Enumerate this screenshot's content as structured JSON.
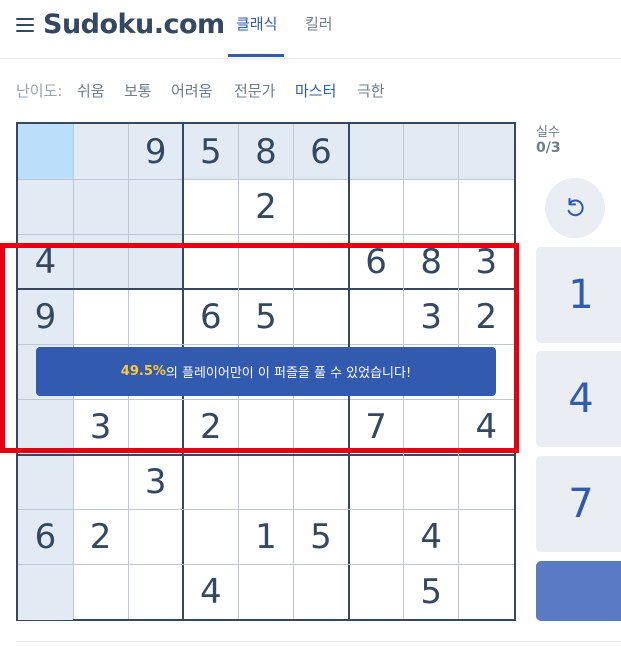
{
  "header": {
    "logo": "Sudoku.com",
    "tabs": [
      {
        "label": "클래식",
        "active": true
      },
      {
        "label": "킬러",
        "active": false
      }
    ]
  },
  "difficulty": {
    "label": "난이도:",
    "levels": [
      {
        "label": "쉬움",
        "active": false
      },
      {
        "label": "보통",
        "active": false
      },
      {
        "label": "어려움",
        "active": false
      },
      {
        "label": "전문가",
        "active": false
      },
      {
        "label": "마스터",
        "active": true
      },
      {
        "label": "극한",
        "active": false
      }
    ]
  },
  "board": {
    "rows": [
      [
        "",
        "",
        "9",
        "5",
        "8",
        "6",
        "",
        "",
        ""
      ],
      [
        "",
        "",
        "",
        "",
        "2",
        "",
        "",
        "",
        ""
      ],
      [
        "4",
        "",
        "",
        "",
        "",
        "",
        "6",
        "8",
        "3"
      ],
      [
        "9",
        "",
        "",
        "6",
        "5",
        "",
        "",
        "3",
        "2"
      ],
      [
        "",
        "",
        "",
        "",
        "",
        "",
        "",
        "",
        ""
      ],
      [
        "",
        "3",
        "",
        "2",
        "",
        "",
        "7",
        "",
        "4"
      ],
      [
        "",
        "",
        "3",
        "",
        "",
        "",
        "",
        "",
        ""
      ],
      [
        "6",
        "2",
        "",
        "",
        "1",
        "5",
        "",
        "4",
        ""
      ],
      [
        "",
        "",
        "",
        "4",
        "",
        "",
        "",
        "5",
        ""
      ]
    ],
    "selected_cell": [
      0,
      0
    ],
    "colors": {
      "selected": "#bbdefb",
      "highlight": "#e2ebf3",
      "digit": "#344861"
    }
  },
  "banner": {
    "percent": "49.5%",
    "message": "의 플레이어만이 이 퍼즐을 풀 수 있었습니다!"
  },
  "side": {
    "mistakes_label": "실수",
    "mistakes_value": "0/3",
    "undo_icon": "undo-icon",
    "numbers": [
      "1",
      "4",
      "7",
      ""
    ]
  },
  "colors": {
    "accent": "#325aaf",
    "banner_highlight": "#ffc93c",
    "annotation_frame": "#e60012"
  }
}
